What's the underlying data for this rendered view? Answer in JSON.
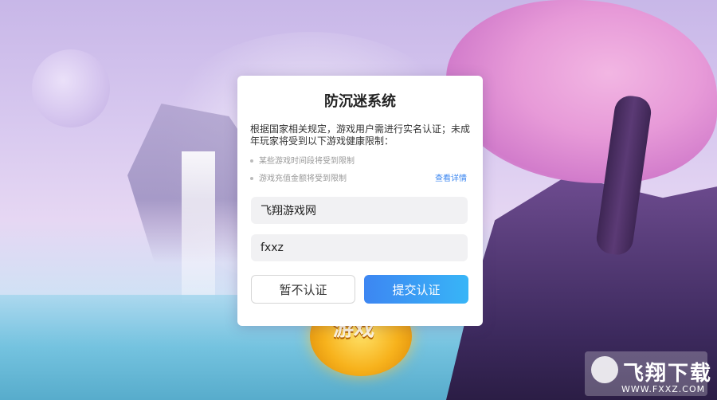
{
  "dialog": {
    "title": "防沉迷系统",
    "description": "根据国家相关规定，游戏用户需进行实名认证；未成年玩家将受到以下游戏健康限制：",
    "rules": [
      "某些游戏时间段将受到限制",
      "游戏充值金额将受到限制"
    ],
    "details_link": "查看详情",
    "name_value": "飞翔游戏网",
    "id_value": "fxxz",
    "skip_label": "暂不认证",
    "submit_label": "提交认证"
  },
  "background": {
    "game_badge_text": "游戏",
    "watermark_text": "飞翔下载",
    "watermark_url": "WWW.FXXZ.COM"
  },
  "colors": {
    "accent": "#3d86f2",
    "link": "#3a86f0"
  }
}
